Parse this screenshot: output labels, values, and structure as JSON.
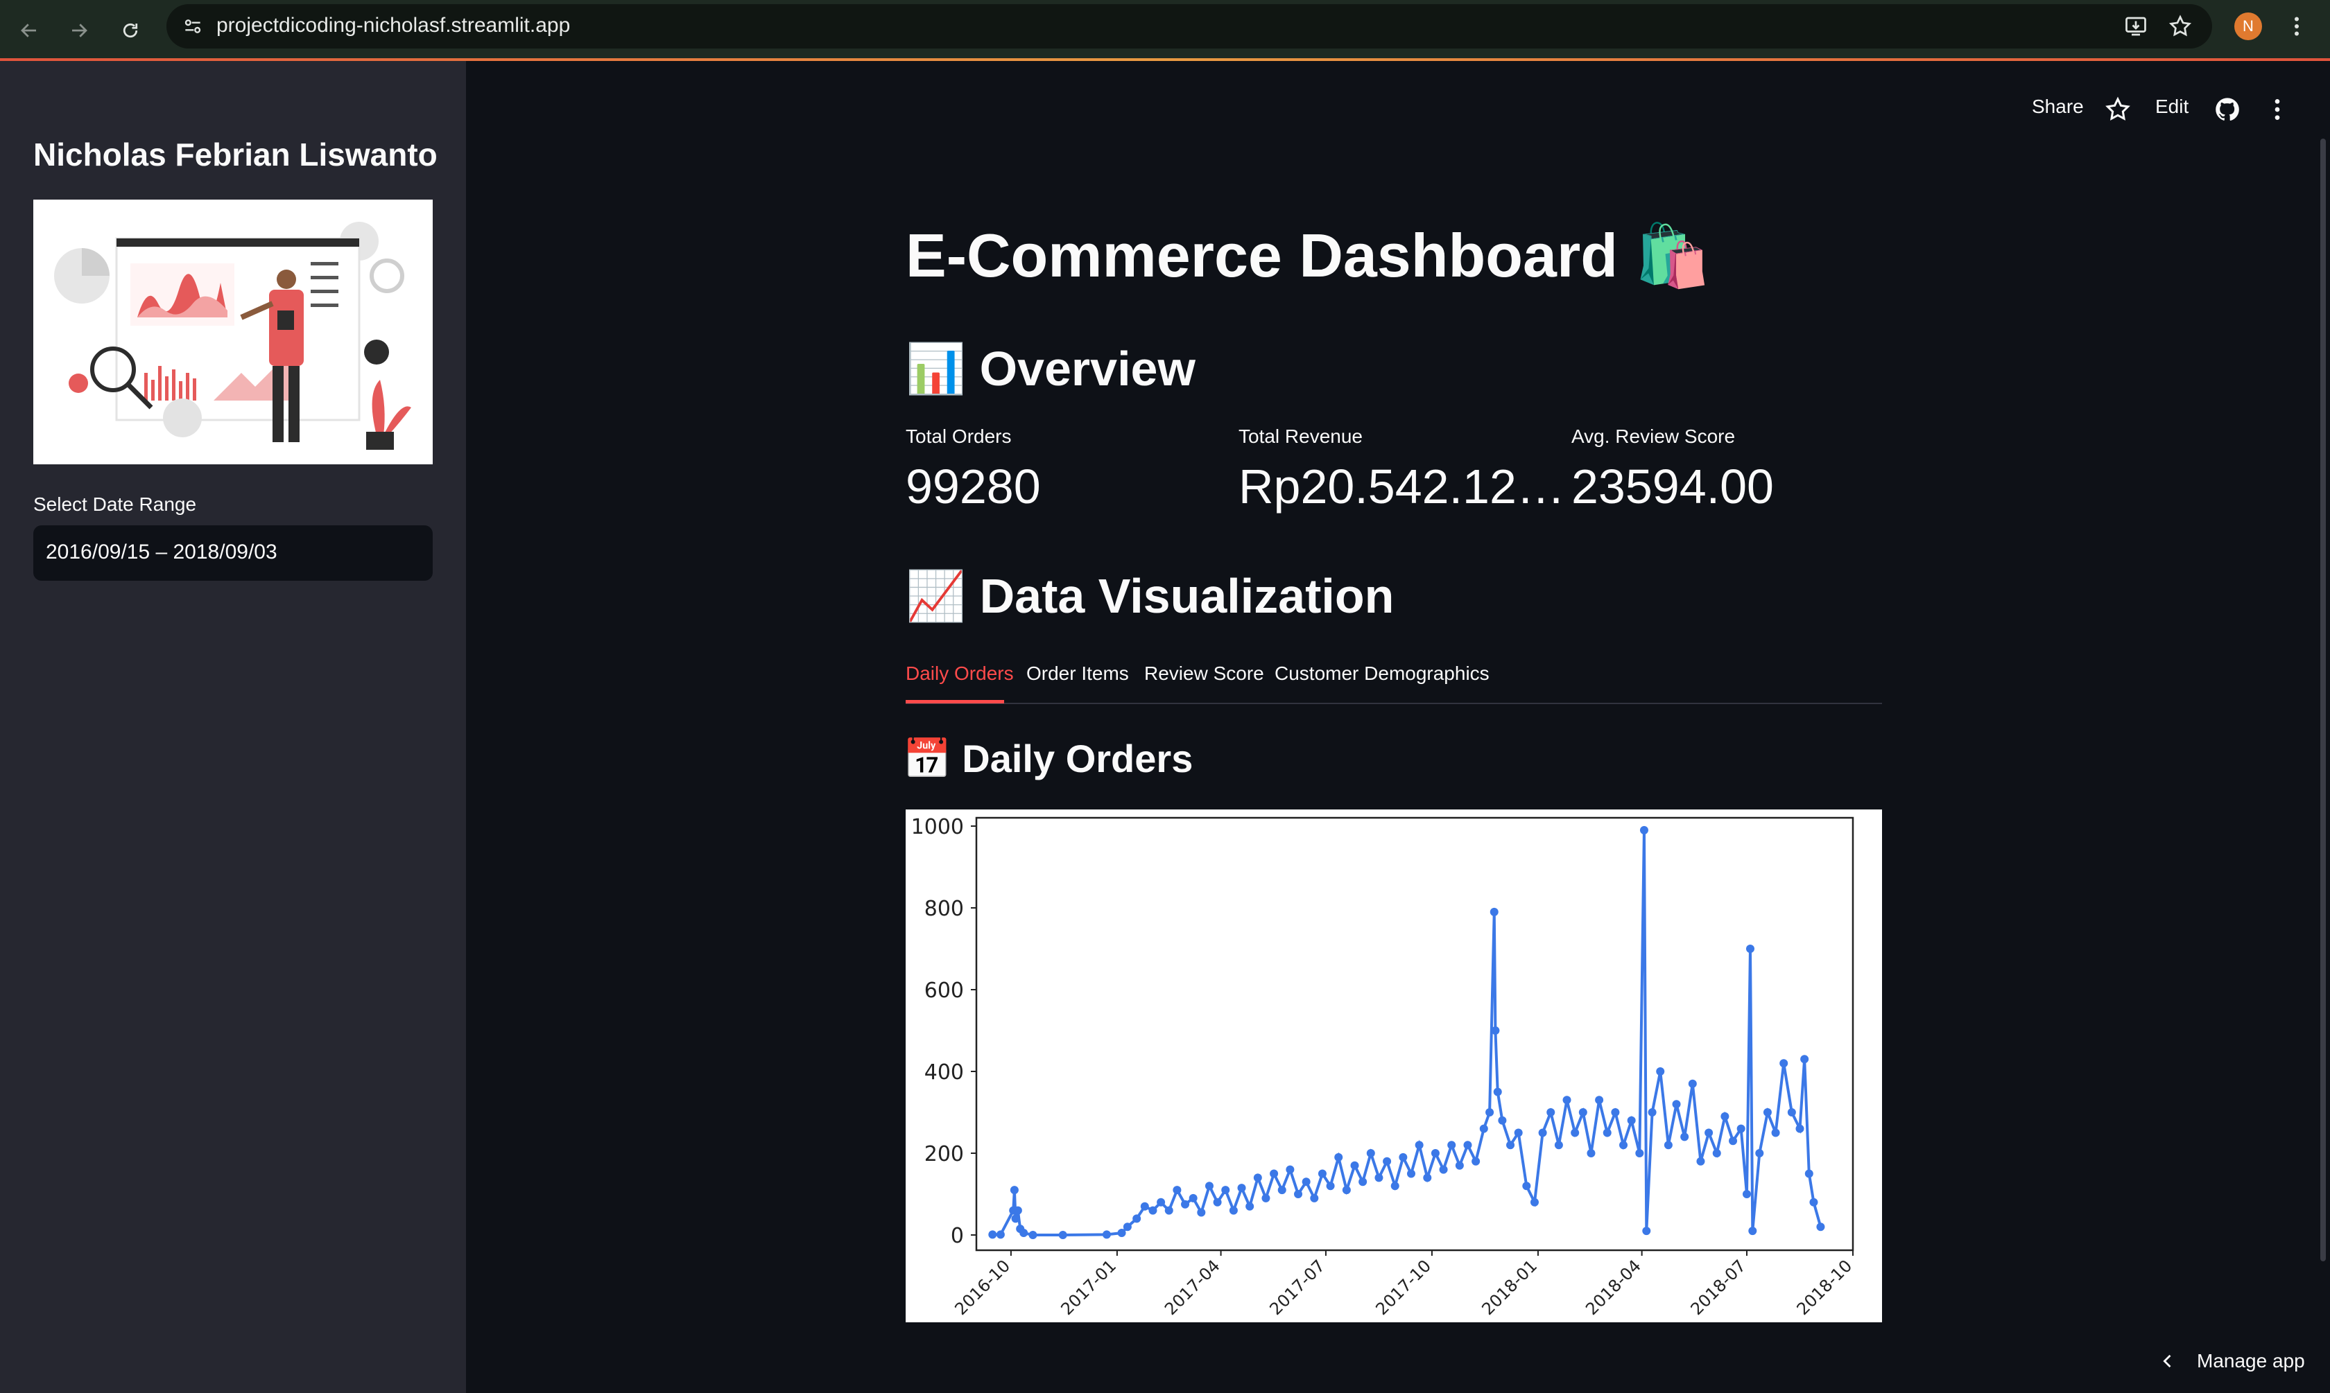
{
  "browser": {
    "url": "projectdicoding-nicholasf.streamlit.app",
    "profile_initial": "N"
  },
  "sidebar": {
    "author_name": "Nicholas Febrian Liswanto",
    "date_range_label": "Select Date Range",
    "date_range_value": "2016/09/15 – 2018/09/03"
  },
  "header": {
    "share_label": "Share",
    "edit_label": "Edit"
  },
  "main": {
    "title": "E-Commerce Dashboard 🛍️",
    "overview_heading": "📊 Overview",
    "metrics": [
      {
        "label": "Total Orders",
        "value": "99280"
      },
      {
        "label": "Total Revenue",
        "value": "Rp20.542.12…"
      },
      {
        "label": "Avg. Review Score",
        "value": "23594.00"
      }
    ],
    "viz_heading": "📈 Data Visualization",
    "tabs": [
      {
        "label": "Daily Orders",
        "active": true
      },
      {
        "label": "Order Items",
        "active": false
      },
      {
        "label": "Review Score",
        "active": false
      },
      {
        "label": "Customer Demographics",
        "active": false
      }
    ],
    "daily_heading": "📅 Daily Orders"
  },
  "footer": {
    "manage_label": "Manage app"
  },
  "colors": {
    "accent": "#ff4b4b",
    "line": "#3b78e7",
    "sidebar_bg": "#262730",
    "main_bg": "#0e1117"
  },
  "chart_data": {
    "type": "line",
    "title": "",
    "xlabel": "",
    "ylabel": "",
    "ylim": [
      0,
      1000
    ],
    "yticks": [
      0,
      200,
      400,
      600,
      800,
      1000
    ],
    "xticks": [
      "2016-10",
      "2017-01",
      "2017-04",
      "2017-07",
      "2017-10",
      "2018-01",
      "2018-04",
      "2018-07",
      "2018-10"
    ],
    "x_range": [
      "2016-09-01",
      "2018-10-01"
    ],
    "markers": true,
    "series": [
      {
        "points": [
          [
            "2016-09-15",
            1
          ],
          [
            "2016-09-22",
            1
          ],
          [
            "2016-10-03",
            60
          ],
          [
            "2016-10-04",
            110
          ],
          [
            "2016-10-05",
            40
          ],
          [
            "2016-10-07",
            60
          ],
          [
            "2016-10-09",
            15
          ],
          [
            "2016-10-12",
            5
          ],
          [
            "2016-10-20",
            0
          ],
          [
            "2016-11-15",
            0
          ],
          [
            "2016-12-23",
            1
          ],
          [
            "2017-01-05",
            5
          ],
          [
            "2017-01-10",
            20
          ],
          [
            "2017-01-18",
            40
          ],
          [
            "2017-01-25",
            70
          ],
          [
            "2017-02-01",
            60
          ],
          [
            "2017-02-08",
            80
          ],
          [
            "2017-02-15",
            60
          ],
          [
            "2017-02-22",
            110
          ],
          [
            "2017-03-01",
            75
          ],
          [
            "2017-03-08",
            90
          ],
          [
            "2017-03-15",
            55
          ],
          [
            "2017-03-22",
            120
          ],
          [
            "2017-03-29",
            80
          ],
          [
            "2017-04-05",
            110
          ],
          [
            "2017-04-12",
            60
          ],
          [
            "2017-04-19",
            115
          ],
          [
            "2017-04-26",
            70
          ],
          [
            "2017-05-03",
            140
          ],
          [
            "2017-05-10",
            90
          ],
          [
            "2017-05-17",
            150
          ],
          [
            "2017-05-24",
            110
          ],
          [
            "2017-05-31",
            160
          ],
          [
            "2017-06-07",
            100
          ],
          [
            "2017-06-14",
            130
          ],
          [
            "2017-06-21",
            90
          ],
          [
            "2017-06-28",
            150
          ],
          [
            "2017-07-05",
            120
          ],
          [
            "2017-07-12",
            190
          ],
          [
            "2017-07-19",
            110
          ],
          [
            "2017-07-26",
            170
          ],
          [
            "2017-08-02",
            130
          ],
          [
            "2017-08-09",
            200
          ],
          [
            "2017-08-16",
            140
          ],
          [
            "2017-08-23",
            180
          ],
          [
            "2017-08-30",
            120
          ],
          [
            "2017-09-06",
            190
          ],
          [
            "2017-09-13",
            150
          ],
          [
            "2017-09-20",
            220
          ],
          [
            "2017-09-27",
            140
          ],
          [
            "2017-10-04",
            200
          ],
          [
            "2017-10-11",
            160
          ],
          [
            "2017-10-18",
            220
          ],
          [
            "2017-10-25",
            170
          ],
          [
            "2017-11-01",
            220
          ],
          [
            "2017-11-08",
            180
          ],
          [
            "2017-11-15",
            260
          ],
          [
            "2017-11-20",
            300
          ],
          [
            "2017-11-24",
            790
          ],
          [
            "2017-11-25",
            500
          ],
          [
            "2017-11-27",
            350
          ],
          [
            "2017-12-01",
            280
          ],
          [
            "2017-12-08",
            220
          ],
          [
            "2017-12-15",
            250
          ],
          [
            "2017-12-22",
            120
          ],
          [
            "2017-12-29",
            80
          ],
          [
            "2018-01-05",
            250
          ],
          [
            "2018-01-12",
            300
          ],
          [
            "2018-01-19",
            220
          ],
          [
            "2018-01-26",
            330
          ],
          [
            "2018-02-02",
            250
          ],
          [
            "2018-02-09",
            300
          ],
          [
            "2018-02-16",
            200
          ],
          [
            "2018-02-23",
            330
          ],
          [
            "2018-03-02",
            250
          ],
          [
            "2018-03-09",
            300
          ],
          [
            "2018-03-16",
            220
          ],
          [
            "2018-03-23",
            280
          ],
          [
            "2018-03-30",
            200
          ],
          [
            "2018-04-03",
            990
          ],
          [
            "2018-04-05",
            10
          ],
          [
            "2018-04-10",
            300
          ],
          [
            "2018-04-17",
            400
          ],
          [
            "2018-04-24",
            220
          ],
          [
            "2018-05-01",
            320
          ],
          [
            "2018-05-08",
            240
          ],
          [
            "2018-05-15",
            370
          ],
          [
            "2018-05-22",
            180
          ],
          [
            "2018-05-29",
            250
          ],
          [
            "2018-06-05",
            200
          ],
          [
            "2018-06-12",
            290
          ],
          [
            "2018-06-19",
            230
          ],
          [
            "2018-06-26",
            260
          ],
          [
            "2018-07-01",
            100
          ],
          [
            "2018-07-04",
            700
          ],
          [
            "2018-07-06",
            10
          ],
          [
            "2018-07-12",
            200
          ],
          [
            "2018-07-19",
            300
          ],
          [
            "2018-07-26",
            250
          ],
          [
            "2018-08-02",
            420
          ],
          [
            "2018-08-09",
            300
          ],
          [
            "2018-08-16",
            260
          ],
          [
            "2018-08-20",
            430
          ],
          [
            "2018-08-24",
            150
          ],
          [
            "2018-08-28",
            80
          ],
          [
            "2018-09-03",
            20
          ]
        ]
      }
    ]
  }
}
